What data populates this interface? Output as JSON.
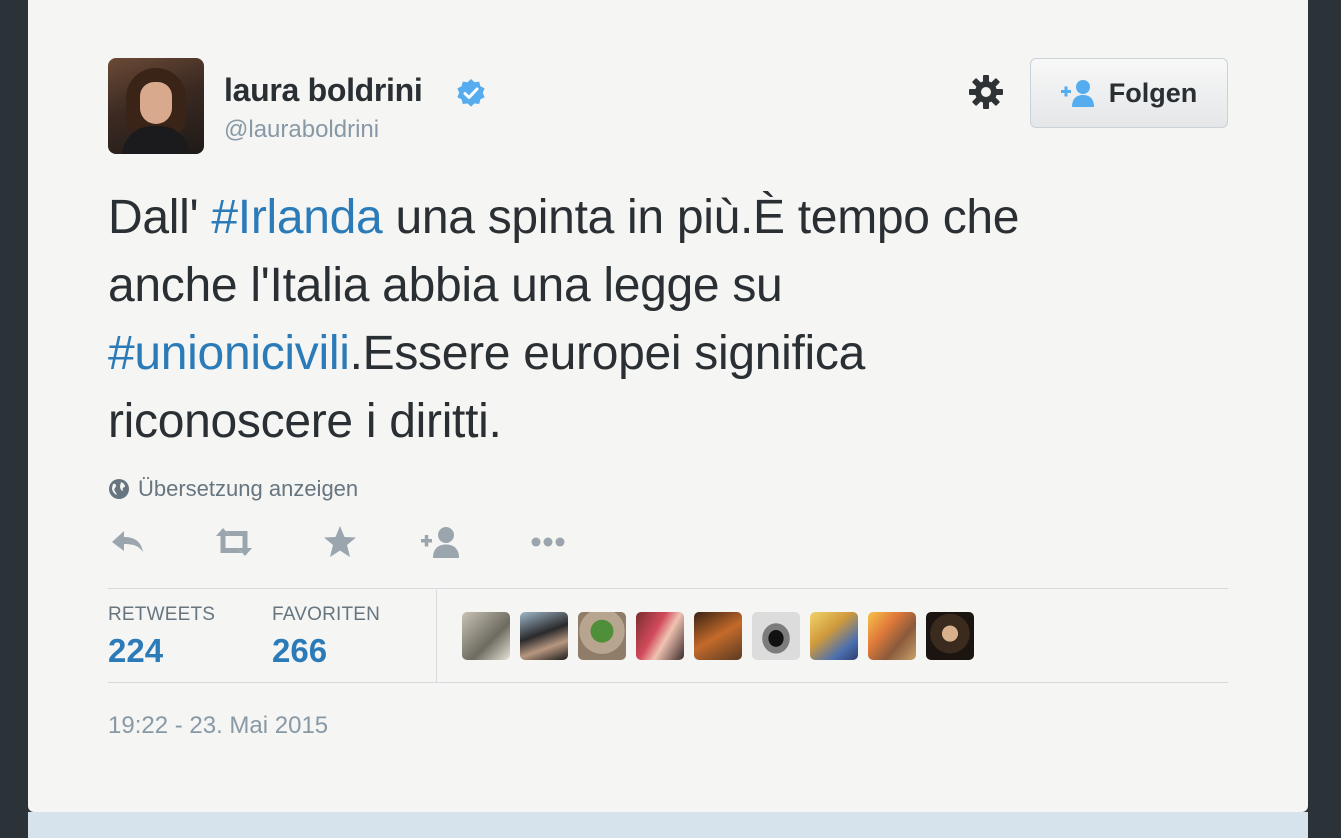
{
  "user": {
    "display_name": "laura boldrini",
    "handle": "@lauraboldrini",
    "verified": true
  },
  "follow_button": {
    "label": "Folgen"
  },
  "tweet": {
    "line1_pre": "Dall' ",
    "hashtag1": "#Irlanda",
    "line1_post": " una spinta in più.È tempo che",
    "line2": "anche l'Italia abbia una legge su",
    "hashtag2": "#unionicivili",
    "line3_post": ".Essere europei significa",
    "line4": "riconoscere i diritti."
  },
  "translate_link": "Übersetzung anzeigen",
  "actions": [
    "reply-icon",
    "retweet-icon",
    "favorite-icon",
    "follow-icon",
    "more-icon"
  ],
  "stats": {
    "retweets_label": "RETWEETS",
    "retweets_value": "224",
    "favorites_label": "FAVORITEN",
    "favorites_value": "266"
  },
  "timestamp": "19:22 - 23. Mai 2015",
  "colors": {
    "link": "#2b7bb9",
    "text": "#292f33",
    "muted": "#8899a6",
    "verified": "#55acee"
  }
}
